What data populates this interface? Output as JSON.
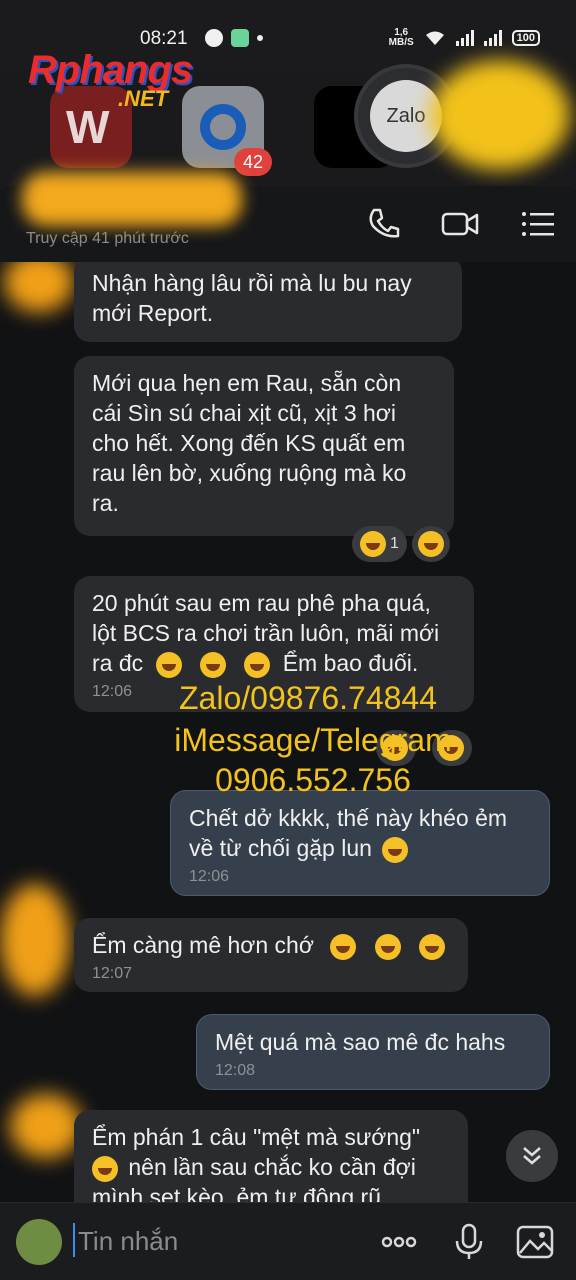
{
  "status": {
    "time": "08:21",
    "net_speed_value": "1,6",
    "net_speed_unit": "MB/S",
    "battery": "100"
  },
  "background": {
    "watermark_main": "Rphangs",
    "watermark_sub": ".NET",
    "badge_count": "42",
    "zalo_label": "Zalo"
  },
  "header": {
    "last_seen": "Truy cập 41 phút trước"
  },
  "messages": [
    {
      "text": "Nhận hàng lâu rồi mà lu bu nay mới Report.",
      "time": ""
    },
    {
      "text": "Mới qua hẹn em Rau, sẵn còn cái Sìn sú chai xịt cũ, xịt 3 hơi cho hết. Xong đến KS quất em rau lên bờ, xuống ruộng mà ko ra.",
      "time": "",
      "reaction_count": "1"
    },
    {
      "text": "20 phút sau em rau phê pha quá, lột BCS ra chơi trần luôn, mãi mới ra đc",
      "tail": "Ểm bao đuối.",
      "time": "12:06"
    },
    {
      "text": "Chết dở kkkk, thế này khéo ẻm về từ chối gặp lun",
      "time": "12:06"
    },
    {
      "text": "Ểm càng mê hơn chớ",
      "time": "12:07"
    },
    {
      "text": "Mệt quá mà sao mê đc hahs",
      "time": "12:08"
    },
    {
      "text": "Ểm phán 1 câu \"mệt mà sướng\"",
      "line2": "nên lần sau chắc ko cần đợi",
      "line3": "mình set kèo, ẻm tự động rũ",
      "time": ""
    }
  ],
  "overlay": {
    "line1": "Zalo/09876.74844",
    "line2": "iMessage/Telegram",
    "line3": "0906.552.756"
  },
  "input": {
    "placeholder": "Tin nhắn"
  }
}
